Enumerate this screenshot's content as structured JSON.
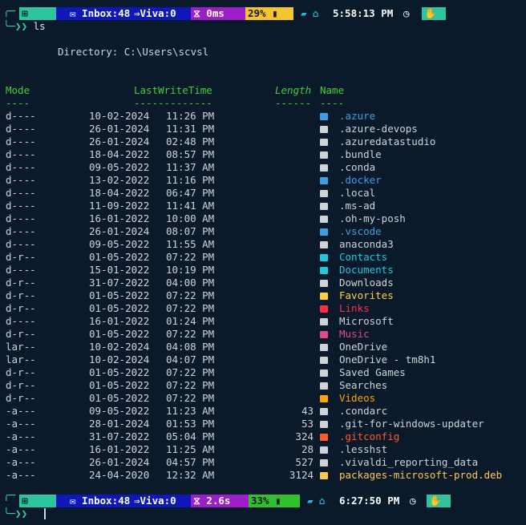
{
  "prompt1": {
    "os": "⊞",
    "inbox": "✉ Inbox:48",
    "viva": "⇒Viva:0",
    "exec": "⧖ 0ms",
    "battery": "29% ▮",
    "path_icons": "▰ ⌂",
    "time": "5:58:13 PM",
    "clock": "◷",
    "hand": "✋"
  },
  "prompt2": {
    "os": "⊞",
    "inbox": "✉ Inbox:48",
    "viva": "⇒Viva:0",
    "exec": "⧖ 2.6s",
    "battery": "33% ▮",
    "path_icons": "▰ ⌂",
    "time": "6:27:50 PM",
    "clock": "◷",
    "hand": "✋"
  },
  "prompt_chars": {
    "line1": "╭─",
    "line2": "╰─❯❯"
  },
  "command": "ls",
  "directory_line": "Directory: C:\\Users\\scvsl",
  "headers": {
    "mode": "Mode",
    "lastwrite": "LastWriteTime",
    "length": "Length",
    "name": "Name"
  },
  "underlines": {
    "mode": "----",
    "lastwrite": "-------------",
    "length": "------",
    "name": "----"
  },
  "colors": {
    "bg": "#0b1a2a",
    "header": "#3fcf3f",
    "text": "#d0d4d8",
    "blue": "#3aa0e6",
    "cyan": "#1ec8e0",
    "yellow": "#ffd23a",
    "red": "#ff3048",
    "pink": "#e04a8a",
    "orange": "#ff5a2a",
    "gold": "#ffc850",
    "amber": "#ffa400"
  },
  "entries": [
    {
      "mode": "d----",
      "date": "10-02-2024",
      "time": "11:26 PM",
      "length": "",
      "name": ".azure",
      "color": "#3aa0e6",
      "icon": "azure-icon"
    },
    {
      "mode": "d----",
      "date": "26-01-2024",
      "time": "11:31 PM",
      "length": "",
      "name": ".azure-devops",
      "color": "#d0d4d8",
      "icon": "folder-icon"
    },
    {
      "mode": "d----",
      "date": "26-01-2024",
      "time": "02:48 PM",
      "length": "",
      "name": ".azuredatastudio",
      "color": "#d0d4d8",
      "icon": "folder-icon"
    },
    {
      "mode": "d----",
      "date": "18-04-2022",
      "time": "08:57 PM",
      "length": "",
      "name": ".bundle",
      "color": "#d0d4d8",
      "icon": "folder-icon"
    },
    {
      "mode": "d----",
      "date": "09-05-2022",
      "time": "11:37 AM",
      "length": "",
      "name": ".conda",
      "color": "#d0d4d8",
      "icon": "folder-icon"
    },
    {
      "mode": "d----",
      "date": "13-02-2022",
      "time": "11:16 PM",
      "length": "",
      "name": ".docker",
      "color": "#3aa0e6",
      "icon": "docker-icon"
    },
    {
      "mode": "d----",
      "date": "18-04-2022",
      "time": "06:47 PM",
      "length": "",
      "name": ".local",
      "color": "#d0d4d8",
      "icon": "folder-icon"
    },
    {
      "mode": "d----",
      "date": "11-09-2022",
      "time": "11:41 AM",
      "length": "",
      "name": ".ms-ad",
      "color": "#d0d4d8",
      "icon": "folder-icon"
    },
    {
      "mode": "d----",
      "date": "16-01-2022",
      "time": "10:00 AM",
      "length": "",
      "name": ".oh-my-posh",
      "color": "#d0d4d8",
      "icon": "folder-icon"
    },
    {
      "mode": "d----",
      "date": "26-01-2024",
      "time": "08:07 PM",
      "length": "",
      "name": ".vscode",
      "color": "#3aa0e6",
      "icon": "vscode-icon"
    },
    {
      "mode": "d----",
      "date": "09-05-2022",
      "time": "11:55 AM",
      "length": "",
      "name": "anaconda3",
      "color": "#d0d4d8",
      "icon": "folder-icon"
    },
    {
      "mode": "d-r--",
      "date": "01-05-2022",
      "time": "07:22 PM",
      "length": "",
      "name": "Contacts",
      "color": "#1ec8e0",
      "icon": "contacts-icon"
    },
    {
      "mode": "d----",
      "date": "15-01-2022",
      "time": "10:19 PM",
      "length": "",
      "name": "Documents",
      "color": "#1ec8e0",
      "icon": "documents-icon"
    },
    {
      "mode": "d-r--",
      "date": "31-07-2022",
      "time": "04:00 PM",
      "length": "",
      "name": "Downloads",
      "color": "#d0d4d8",
      "icon": "downloads-icon"
    },
    {
      "mode": "d-r--",
      "date": "01-05-2022",
      "time": "07:22 PM",
      "length": "",
      "name": "Favorites",
      "color": "#ffd23a",
      "icon": "favorites-icon"
    },
    {
      "mode": "d-r--",
      "date": "01-05-2022",
      "time": "07:22 PM",
      "length": "",
      "name": "Links",
      "color": "#ff3048",
      "icon": "links-icon"
    },
    {
      "mode": "d----",
      "date": "16-01-2022",
      "time": "01:24 PM",
      "length": "",
      "name": "Microsoft",
      "color": "#d0d4d8",
      "icon": "folder-icon"
    },
    {
      "mode": "d-r--",
      "date": "01-05-2022",
      "time": "07:22 PM",
      "length": "",
      "name": "Music",
      "color": "#e04a8a",
      "icon": "music-icon"
    },
    {
      "mode": "lar--",
      "date": "10-02-2024",
      "time": "04:08 PM",
      "length": "",
      "name": "OneDrive",
      "color": "#d0d4d8",
      "icon": "cloud-icon"
    },
    {
      "mode": "lar--",
      "date": "10-02-2024",
      "time": "04:07 PM",
      "length": "",
      "name": "OneDrive - tm8h1",
      "color": "#d0d4d8",
      "icon": "cloud-icon"
    },
    {
      "mode": "d-r--",
      "date": "01-05-2022",
      "time": "07:22 PM",
      "length": "",
      "name": "Saved Games",
      "color": "#d0d4d8",
      "icon": "folder-icon"
    },
    {
      "mode": "d-r--",
      "date": "01-05-2022",
      "time": "07:22 PM",
      "length": "",
      "name": "Searches",
      "color": "#d0d4d8",
      "icon": "folder-icon"
    },
    {
      "mode": "d-r--",
      "date": "01-05-2022",
      "time": "07:22 PM",
      "length": "",
      "name": "Videos",
      "color": "#ffa400",
      "icon": "videos-icon"
    },
    {
      "mode": "-a---",
      "date": "09-05-2022",
      "time": "11:23 AM",
      "length": "43",
      "name": ".condarc",
      "color": "#d0d4d8",
      "icon": "file-icon"
    },
    {
      "mode": "-a---",
      "date": "28-01-2024",
      "time": "01:53 PM",
      "length": "53",
      "name": ".git-for-windows-updater",
      "color": "#d0d4d8",
      "icon": "file-icon"
    },
    {
      "mode": "-a---",
      "date": "31-07-2022",
      "time": "05:04 PM",
      "length": "324",
      "name": ".gitconfig",
      "color": "#ff5a2a",
      "icon": "git-icon"
    },
    {
      "mode": "-a---",
      "date": "16-01-2022",
      "time": "11:25 AM",
      "length": "28",
      "name": ".lesshst",
      "color": "#d0d4d8",
      "icon": "file-icon"
    },
    {
      "mode": "-a---",
      "date": "26-01-2024",
      "time": "04:57 PM",
      "length": "527",
      "name": ".vivaldi_reporting_data",
      "color": "#d0d4d8",
      "icon": "file-icon"
    },
    {
      "mode": "-a---",
      "date": "24-04-2020",
      "time": "12:32 AM",
      "length": "3124",
      "name": "packages-microsoft-prod.deb",
      "color": "#ffc850",
      "icon": "package-icon"
    }
  ]
}
